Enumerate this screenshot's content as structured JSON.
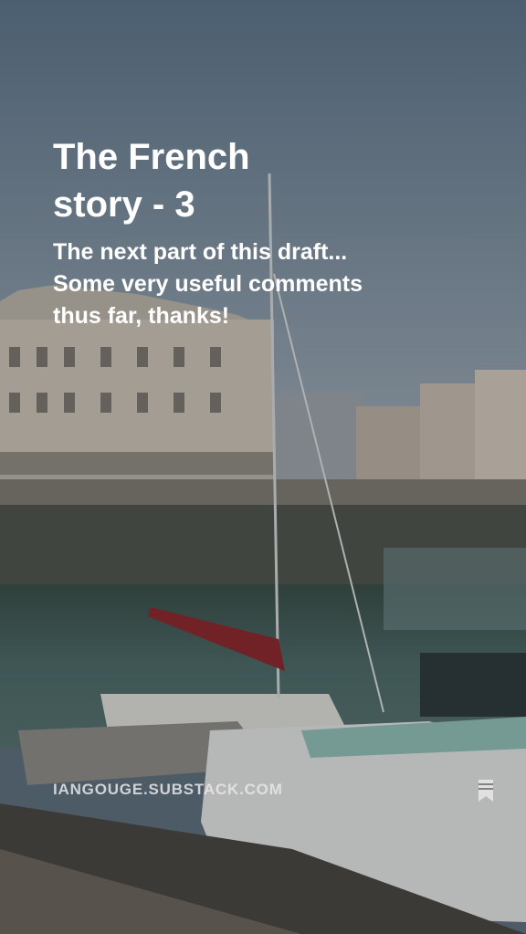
{
  "post": {
    "title": "The French story - 3",
    "subtitle": "The next part of this draft... Some very useful comments thus far, thanks!",
    "domain": "IANGOUGE.SUBSTACK.COM"
  },
  "icons": {
    "save": "bookmark-icon"
  },
  "colors": {
    "text": "#ffffff",
    "sky": "#6f8293",
    "water": "#3c5552"
  }
}
